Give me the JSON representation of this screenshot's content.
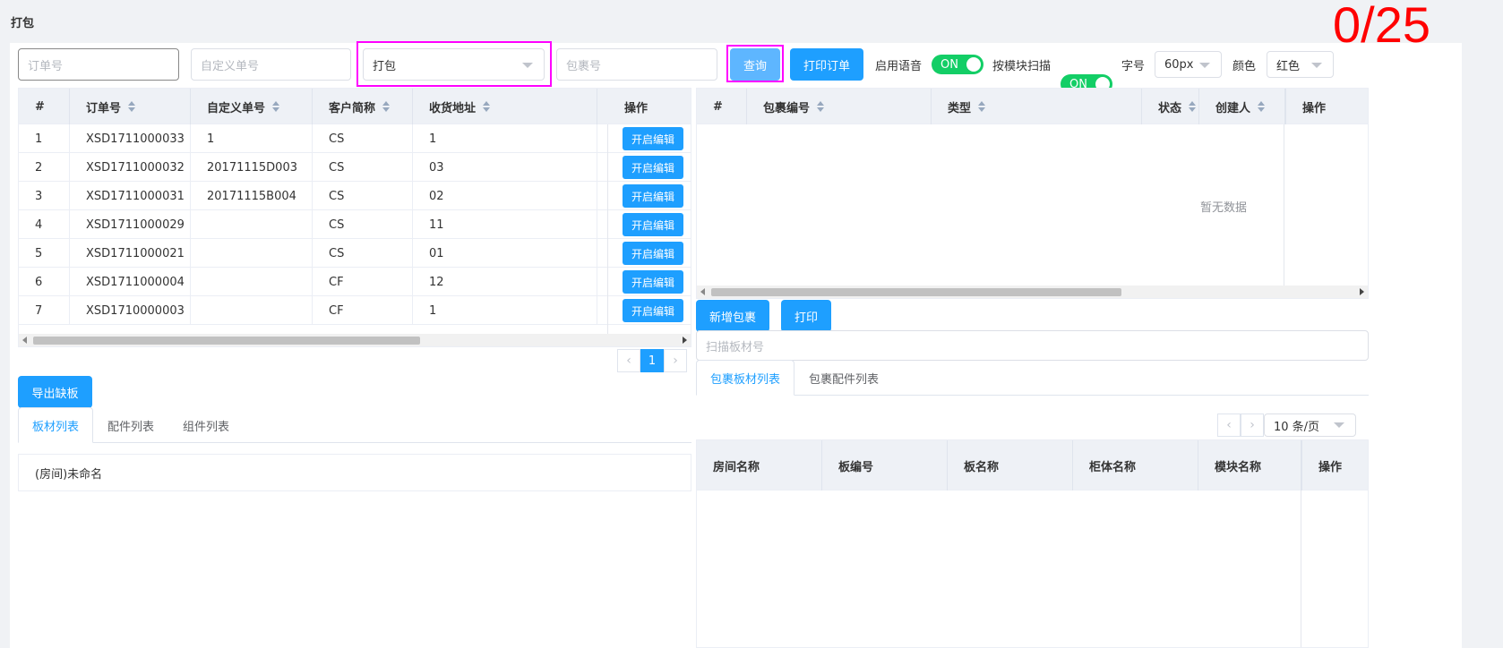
{
  "page_title": "打包",
  "counter": "0/25",
  "toolbar": {
    "order_no_placeholder": "订单号",
    "custom_no_placeholder": "自定义单号",
    "type_value": "打包",
    "package_no_placeholder": "包裹号",
    "query_label": "查询",
    "print_order_label": "打印订单",
    "voice_label": "启用语音",
    "voice_switch": "ON",
    "module_scan_label": "按模块扫描",
    "module_scan_switch": "ON",
    "font_label": "字号",
    "font_value": "60px",
    "color_label": "颜色",
    "color_value": "红色"
  },
  "orders_table": {
    "headers": [
      "#",
      "订单号",
      "自定义单号",
      "客户简称",
      "收货地址",
      "操作"
    ],
    "rows": [
      {
        "idx": "1",
        "order_no": "XSD1711000033",
        "custom_no": "1",
        "customer": "CS",
        "address": "1"
      },
      {
        "idx": "2",
        "order_no": "XSD1711000032",
        "custom_no": "20171115D003",
        "customer": "CS",
        "address": "03"
      },
      {
        "idx": "3",
        "order_no": "XSD1711000031",
        "custom_no": "20171115B004",
        "customer": "CS",
        "address": "02"
      },
      {
        "idx": "4",
        "order_no": "XSD1711000029",
        "custom_no": "",
        "customer": "CS",
        "address": "11"
      },
      {
        "idx": "5",
        "order_no": "XSD1711000021",
        "custom_no": "",
        "customer": "CS",
        "address": "01"
      },
      {
        "idx": "6",
        "order_no": "XSD1711000004",
        "custom_no": "",
        "customer": "CF",
        "address": "12"
      },
      {
        "idx": "7",
        "order_no": "XSD1710000003",
        "custom_no": "",
        "customer": "CF",
        "address": "1"
      }
    ],
    "row_action": "开启编辑",
    "page": "1"
  },
  "packages_table": {
    "headers": [
      "#",
      "包裹编号",
      "类型",
      "状态",
      "创建人",
      "操作"
    ],
    "empty_text": "暂无数据"
  },
  "package_actions": {
    "add_label": "新增包裹",
    "print_label": "打印",
    "scan_placeholder": "扫描板材号"
  },
  "export_label": "导出缺板",
  "left_tabs": [
    "板材列表",
    "配件列表",
    "组件列表"
  ],
  "left_list": {
    "item": "(房间)未命名"
  },
  "right_tabs": [
    "包裹板材列表",
    "包裹配件列表"
  ],
  "page_size": "10 条/页",
  "boards_table": {
    "headers": [
      "房间名称",
      "板编号",
      "板名称",
      "柜体名称",
      "模块名称",
      "操作"
    ]
  }
}
